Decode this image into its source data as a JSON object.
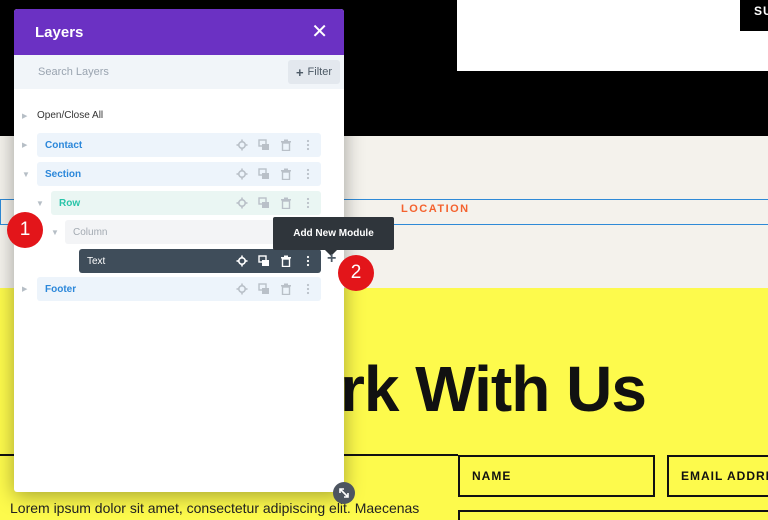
{
  "background": {
    "subscribe_button": "SU",
    "location_label": "LOCATION",
    "hero_heading": "rk With Us",
    "form_fields": {
      "name": "NAME",
      "email": "EMAIL ADDRE"
    },
    "lorem": "Lorem ipsum dolor sit amet, consectetur adipiscing elit. Maecenas"
  },
  "layers_panel": {
    "title": "Layers",
    "close_icon": "close-icon",
    "search": {
      "placeholder": "Search Layers",
      "value": ""
    },
    "filter_label": "Filter",
    "open_close_all": "Open/Close All",
    "items": [
      {
        "label": "Contact",
        "type": "section"
      },
      {
        "label": "Section",
        "type": "section"
      },
      {
        "label": "Row",
        "type": "row"
      },
      {
        "label": "Column",
        "type": "column"
      },
      {
        "label": "Text",
        "type": "module",
        "selected": true
      },
      {
        "label": "Footer",
        "type": "section"
      }
    ],
    "action_icons": [
      "gear-icon",
      "duplicate-icon",
      "trash-icon",
      "more-icon"
    ]
  },
  "overlays": {
    "badge_1": "1",
    "badge_2": "2",
    "tooltip": "Add New Module",
    "add_module_icon": "plus-icon",
    "resize_icon": "resize-icon"
  },
  "colors": {
    "panel_header": "#6b31c3",
    "section_label": "#2b87da",
    "row_label": "#29c4a9",
    "selected_row": "#3f4d5a",
    "badge": "#e3151a",
    "page_yellow": "#fdfa4c",
    "location": "#f4622e"
  }
}
